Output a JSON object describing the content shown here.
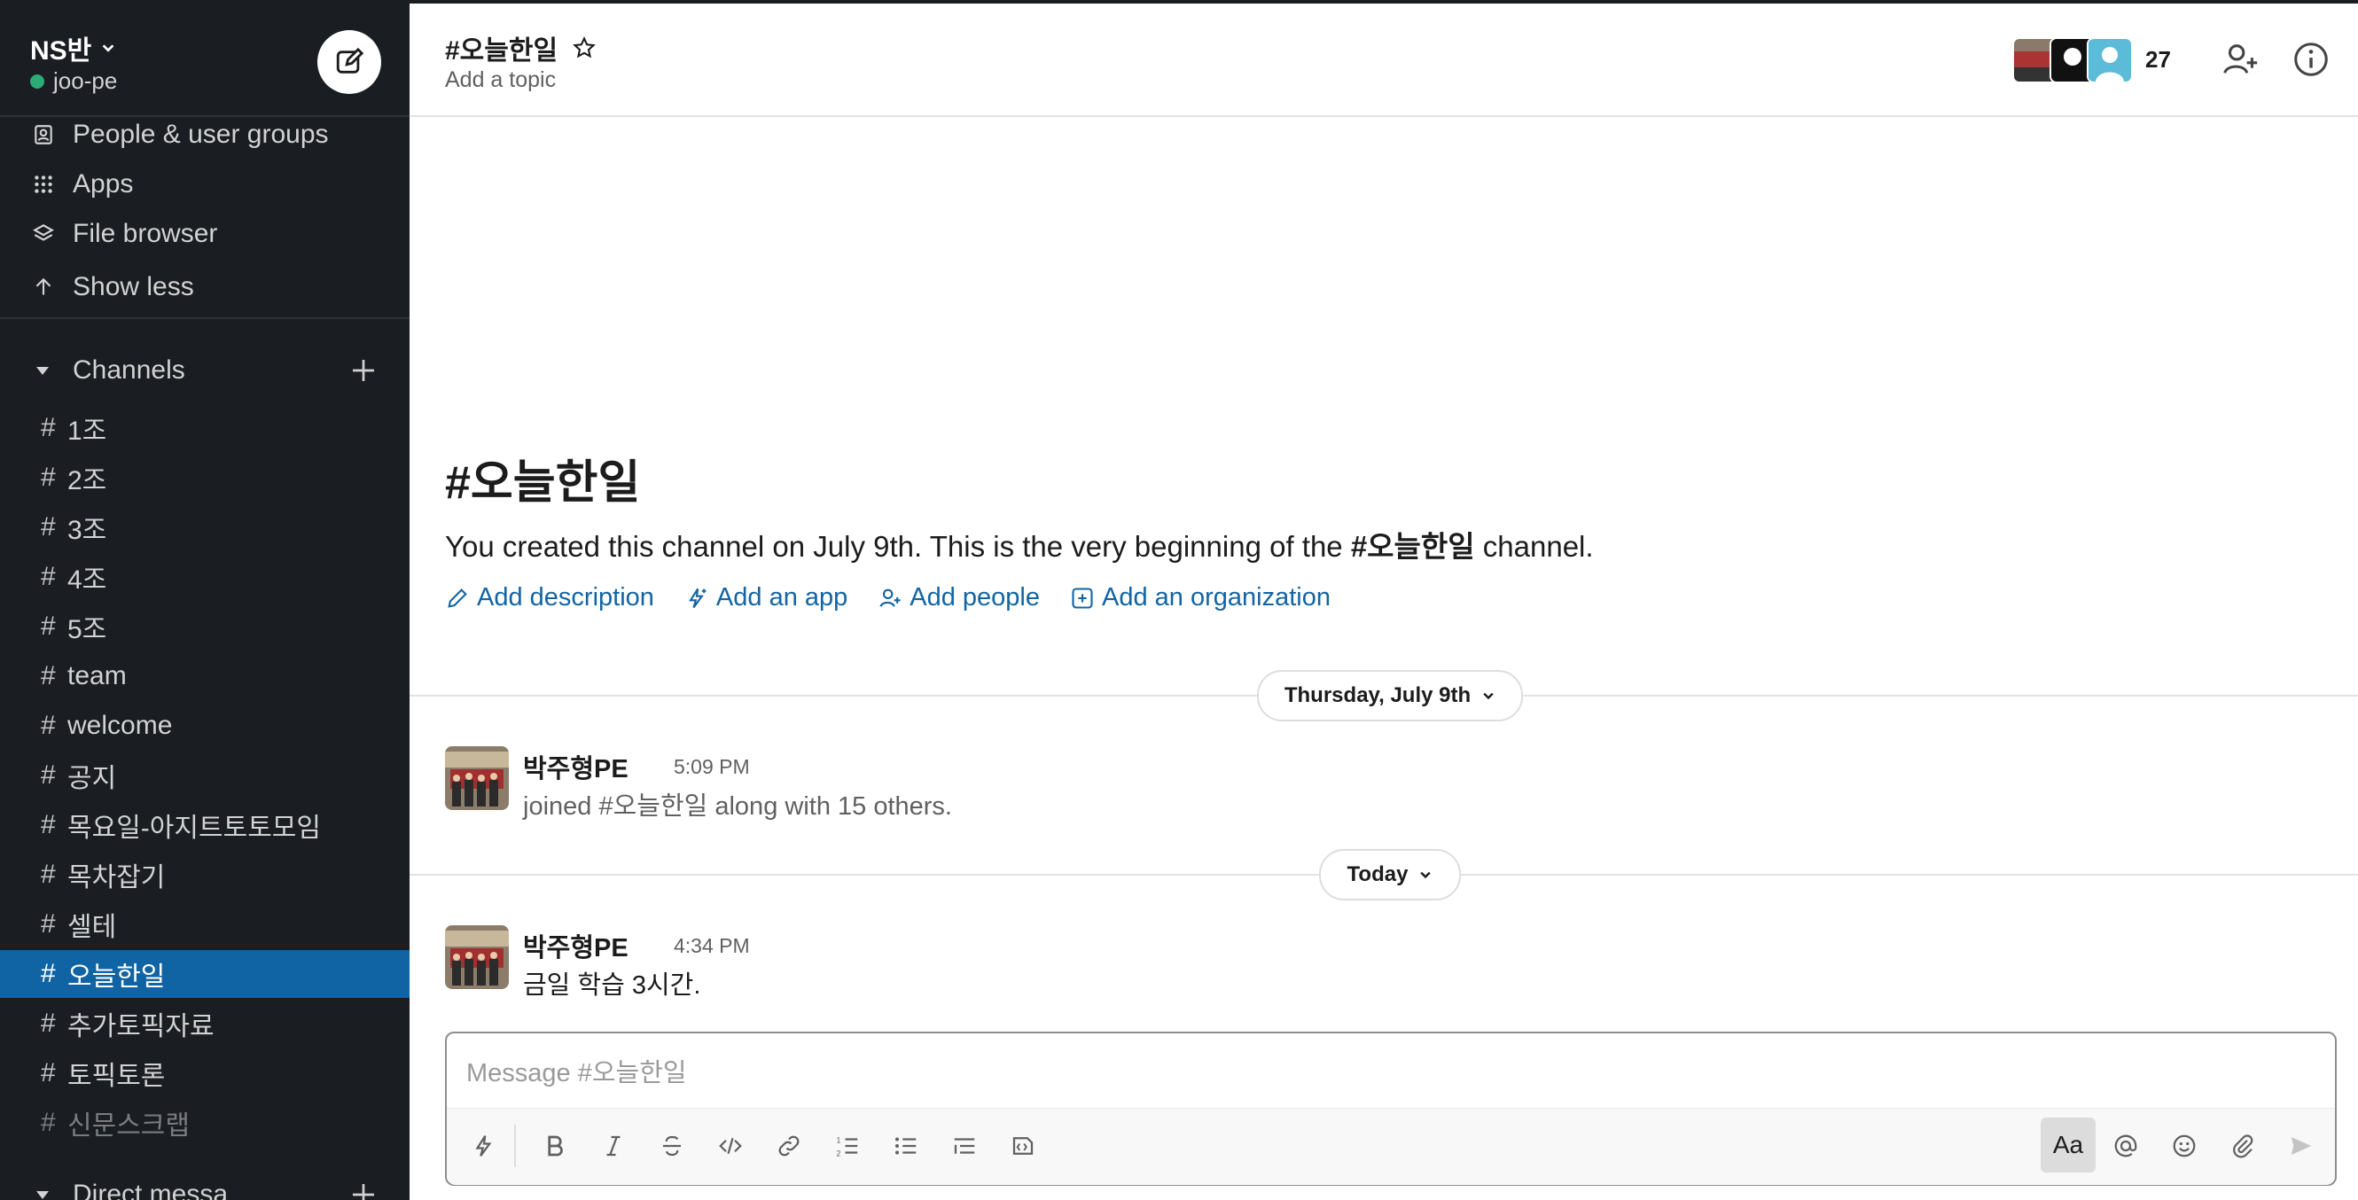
{
  "workspace": {
    "name": "NS반",
    "user": "joo-pe"
  },
  "sidebar": {
    "nav": [
      {
        "label": "People & user groups",
        "icon": "people-icon"
      },
      {
        "label": "Apps",
        "icon": "apps-grid-icon"
      },
      {
        "label": "File browser",
        "icon": "layers-icon"
      },
      {
        "label": "Show less",
        "icon": "arrow-up-icon"
      }
    ],
    "channels_header": "Channels",
    "channels": [
      "1조",
      "2조",
      "3조",
      "4조",
      "5조",
      "team",
      "welcome",
      "공지",
      "목요일-아지트토토모임",
      "목차잡기",
      "셀테",
      "오늘한일",
      "추가토픽자료",
      "토픽토론",
      "신문스크랩"
    ],
    "active_channel": "오늘한일",
    "dm_header": "Direct messa"
  },
  "channel": {
    "title": "#오늘한일",
    "topic": "Add a topic",
    "member_count": "27"
  },
  "intro": {
    "title": "#오늘한일",
    "text_before": "You created this channel on July 9th. This is the very beginning of the ",
    "channel_bold": "#오늘한일",
    "text_after": " channel.",
    "actions": [
      "Add description",
      "Add an app",
      "Add people",
      "Add an organization"
    ]
  },
  "dividers": {
    "first": "Thursday, July 9th",
    "second": "Today"
  },
  "messages": [
    {
      "author": "박주형PE",
      "time": "5:09 PM",
      "text": "joined #오늘한일 along with 15 others."
    },
    {
      "author": "박주형PE",
      "time": "4:34 PM",
      "text": "금일 학습 3시간."
    }
  ],
  "composer": {
    "placeholder": "Message #오늘한일",
    "format_toggle": "Aa"
  },
  "colors": {
    "sidebar_bg": "#1a1d21",
    "active_channel_bg": "#1164a3",
    "link": "#1264a3",
    "presence": "#2bac76"
  }
}
